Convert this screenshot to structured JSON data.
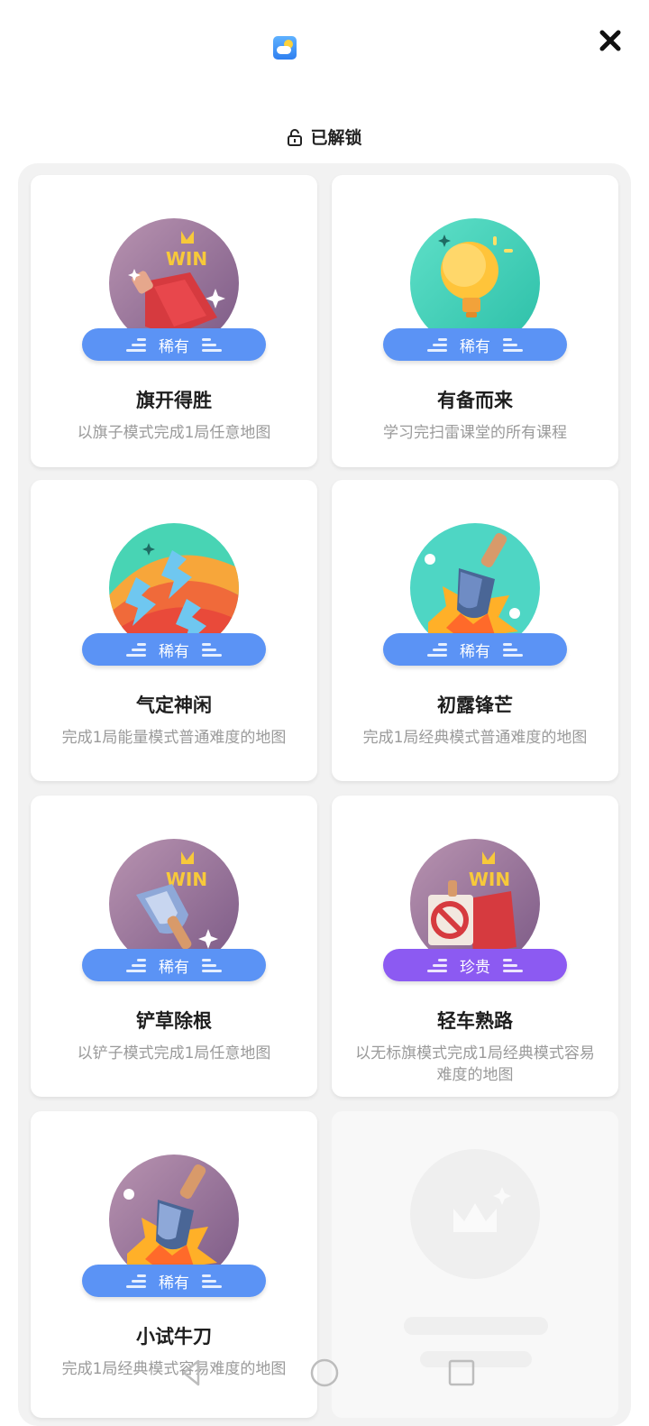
{
  "header": {
    "app_icon": "weather-app-icon",
    "close_icon": "close-icon"
  },
  "unlock": {
    "label": "已解锁",
    "icon": "unlock-icon"
  },
  "achievements": [
    {
      "title": "旗开得胜",
      "desc": "以旗子模式完成1局任意地图",
      "rarity": "稀有",
      "badge": "flag-win-badge"
    },
    {
      "title": "有备而来",
      "desc": "学习完扫雷课堂的所有课程",
      "rarity": "稀有",
      "badge": "lightbulb-badge"
    },
    {
      "title": "气定神闲",
      "desc": "完成1局能量模式普通难度的地图",
      "rarity": "稀有",
      "badge": "lightning-rainbow-badge"
    },
    {
      "title": "初露锋芒",
      "desc": "完成1局经典模式普通难度的地图",
      "rarity": "稀有",
      "badge": "shovel-teal-badge"
    },
    {
      "title": "铲草除根",
      "desc": "以铲子模式完成1局任意地图",
      "rarity": "稀有",
      "badge": "shovel-win-badge"
    },
    {
      "title": "轻车熟路",
      "desc": "以无标旗模式完成1局经典模式容易难度的地图",
      "rarity": "珍贵",
      "badge": "no-flag-win-badge"
    },
    {
      "title": "小试牛刀",
      "desc": "完成1局经典模式容易难度的地图",
      "rarity": "稀有",
      "badge": "shovel-purple-badge"
    }
  ],
  "locked_placeholder": {
    "icon": "crown-placeholder-icon"
  },
  "colors": {
    "rare": "#5b93f5",
    "precious": "#8c5af2",
    "grid_bg": "#f2f2f2"
  },
  "nav": {
    "back": "back-triangle-icon",
    "home": "home-circle-icon",
    "recents": "recents-square-icon"
  }
}
